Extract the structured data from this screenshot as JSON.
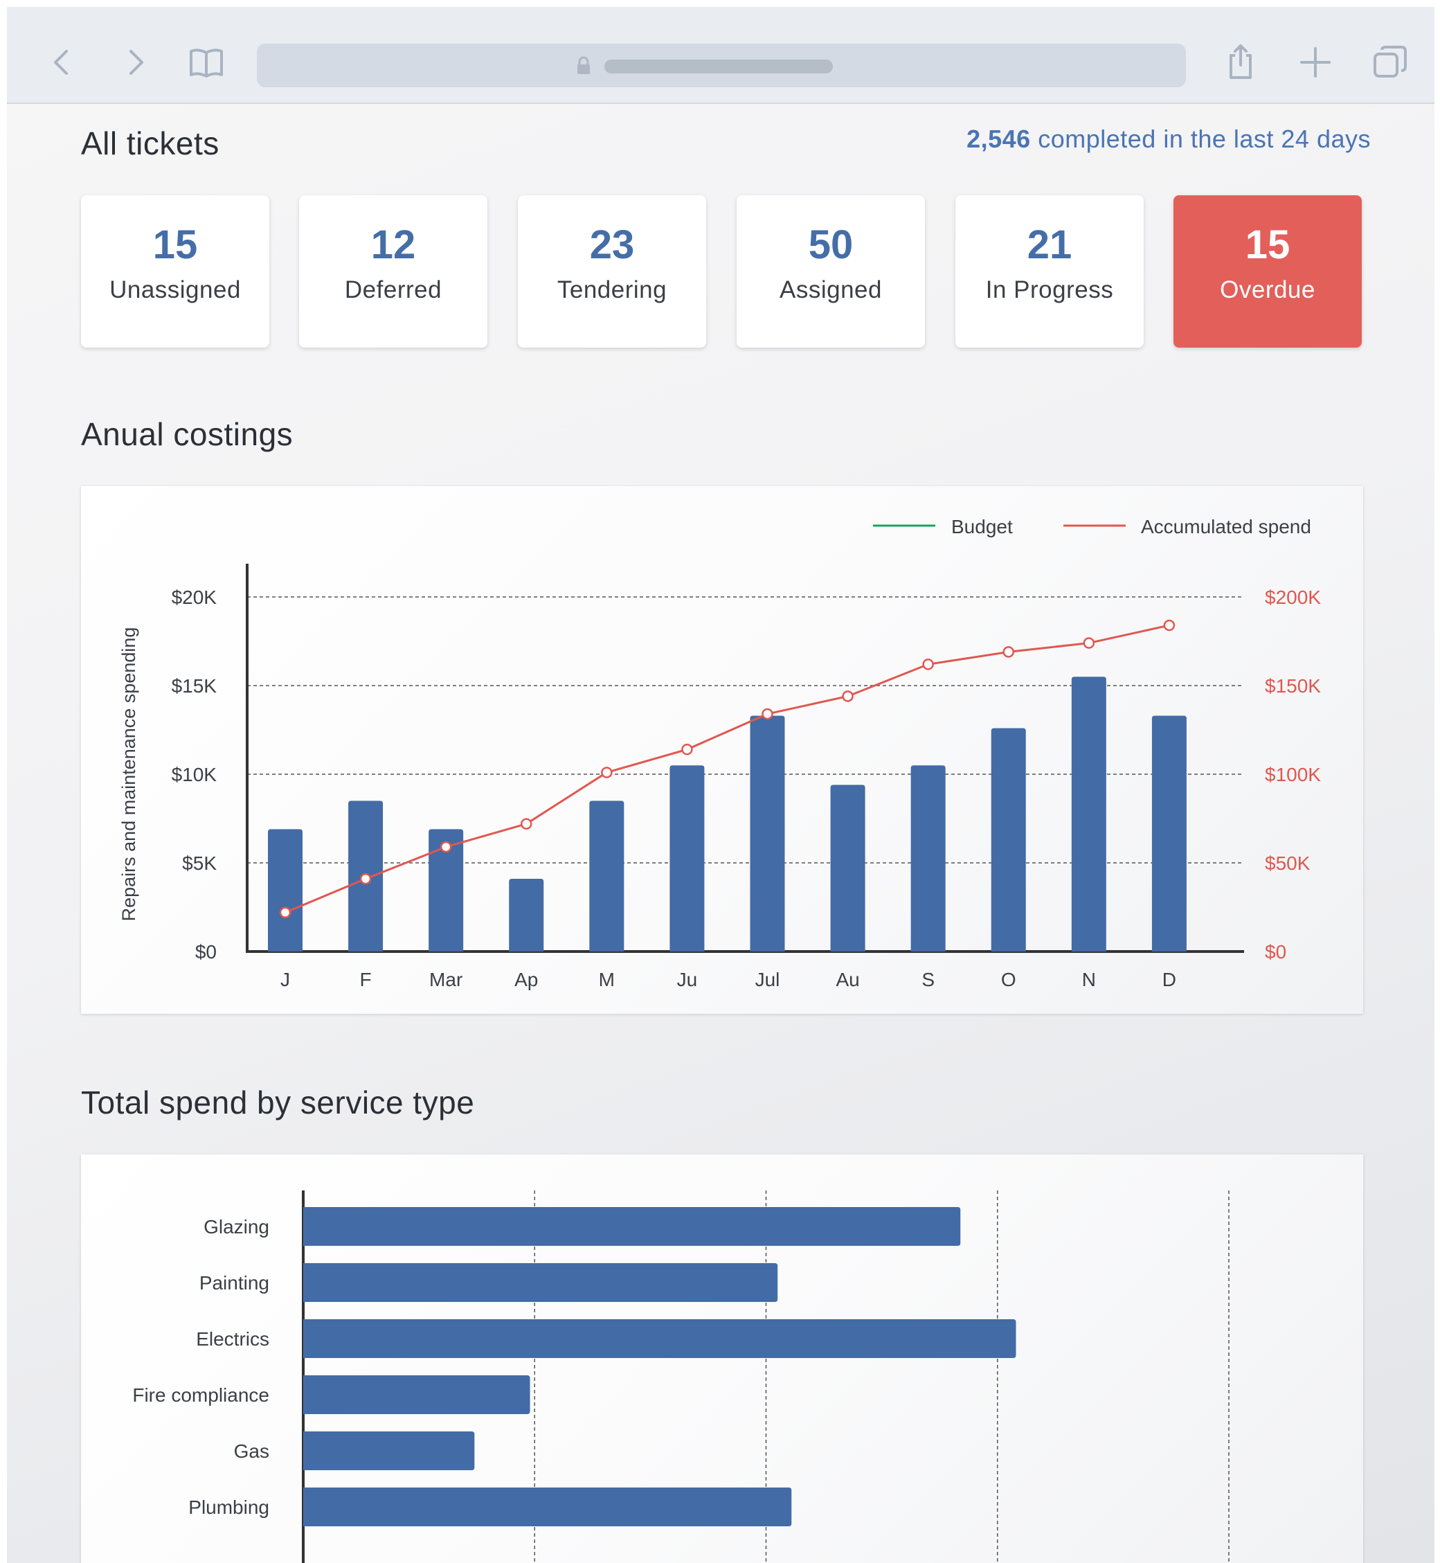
{
  "tickets": {
    "title": "All tickets",
    "completed_count": "2,546",
    "completed_text": "completed in the last 24 days",
    "cards": [
      {
        "value": "15",
        "label": "Unassigned"
      },
      {
        "value": "12",
        "label": "Deferred"
      },
      {
        "value": "23",
        "label": "Tendering"
      },
      {
        "value": "50",
        "label": "Assigned"
      },
      {
        "value": "21",
        "label": "In Progress"
      },
      {
        "value": "15",
        "label": "Overdue"
      }
    ]
  },
  "colors": {
    "bar": "#436ba5",
    "budget": "#1aa35c",
    "spend": "#e0574f",
    "overdue": "#e35f5a",
    "accent_text": "#4a74b4"
  },
  "icons": [
    "back-arrow-icon",
    "forward-arrow-icon",
    "bookmarks-icon",
    "lock-icon",
    "share-icon",
    "plus-icon",
    "tabs-icon"
  ],
  "annual": {
    "title": "Anual costings"
  },
  "service": {
    "title": "Total spend by service type"
  },
  "chart_data": [
    {
      "type": "bar",
      "title": "",
      "categories": [
        "J",
        "F",
        "Mar",
        "Ap",
        "M",
        "Ju",
        "Jul",
        "Au",
        "S",
        "O",
        "N",
        "D"
      ],
      "ylabel": "Repairs and maintenance spending",
      "ylim": [
        0,
        20000
      ],
      "y_ticks": [
        "$0",
        "$5K",
        "$10K",
        "$15K",
        "$20K"
      ],
      "y2lim": [
        0,
        200000
      ],
      "y2_ticks": [
        "$0",
        "$50K",
        "$100K",
        "$150K",
        "$200K"
      ],
      "grid": true,
      "legend_position": "top-right",
      "legend": [
        "Budget",
        "Accumulated spend"
      ],
      "series": [
        {
          "name": "Repairs and maintenance spending",
          "type": "bar",
          "axis": "left",
          "values": [
            6900,
            8500,
            6900,
            4100,
            8500,
            10500,
            13300,
            9400,
            10500,
            12600,
            15500,
            13300
          ]
        },
        {
          "name": "Accumulated spend",
          "type": "line",
          "axis": "right",
          "values": [
            22000,
            41000,
            59000,
            72000,
            101000,
            114000,
            134000,
            144000,
            162000,
            169000,
            174000,
            184000
          ]
        },
        {
          "name": "Budget",
          "type": "line",
          "axis": "right",
          "values": []
        }
      ]
    },
    {
      "type": "bar",
      "orientation": "horizontal",
      "title": "",
      "categories": [
        "Glazing",
        "Painting",
        "Electrics",
        "Fire compliance",
        "Gas",
        "Plumbing"
      ],
      "values": [
        2.84,
        2.05,
        3.08,
        0.98,
        0.74,
        2.11
      ],
      "xlim": [
        0,
        4
      ],
      "grid": true
    }
  ]
}
